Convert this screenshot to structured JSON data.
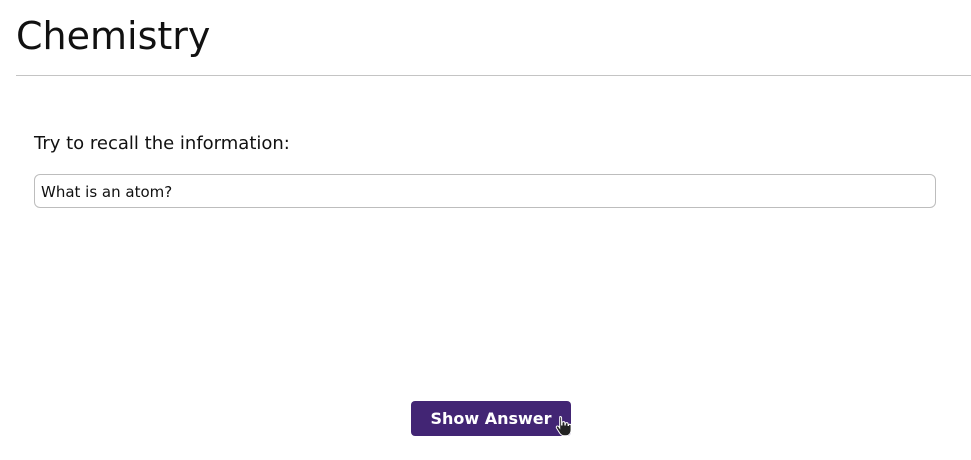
{
  "page": {
    "title": "Chemistry"
  },
  "card": {
    "prompt_label": "Try to recall the information:",
    "question": "What is an atom?",
    "show_answer_label": "Show Answer"
  },
  "colors": {
    "accent": "#422574"
  }
}
